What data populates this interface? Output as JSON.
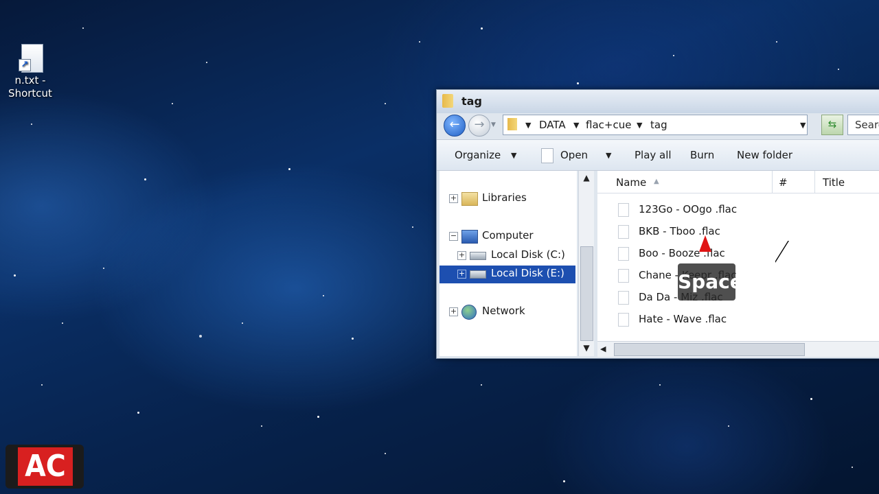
{
  "desktop": {
    "icons": [
      {
        "label_line1": "n.txt -",
        "label_line2": "Shortcut"
      }
    ]
  },
  "window": {
    "title": "tag",
    "address": {
      "breadcrumbs": [
        "DATA",
        "flac+cue",
        "tag"
      ]
    },
    "search_placeholder": "Searc",
    "toolbar": {
      "organize": "Organize",
      "open": "Open",
      "play_all": "Play all",
      "burn": "Burn",
      "new_folder": "New folder"
    },
    "nav_tree": [
      {
        "label": "Libraries",
        "expander": "+",
        "selected": false
      },
      {
        "label": "Computer",
        "expander": "−",
        "selected": false
      },
      {
        "label": "Local Disk (C:)",
        "expander": "+",
        "selected": false
      },
      {
        "label": "Local Disk (E:)",
        "expander": "+",
        "selected": true
      },
      {
        "label": "Network",
        "expander": "+",
        "selected": false
      }
    ],
    "columns": {
      "name": "Name",
      "number": "#",
      "title": "Title"
    },
    "files": [
      "123Go  - OOgo .flac",
      "BKB  - Tboo .flac",
      "Boo  - Booze .flac",
      "Chane  - Keepr .flac",
      "Da Da  - Miz .flac",
      "Hate  - Wave .flac"
    ]
  },
  "overlay": {
    "key_hint": "Space",
    "logo_text": "AC"
  }
}
